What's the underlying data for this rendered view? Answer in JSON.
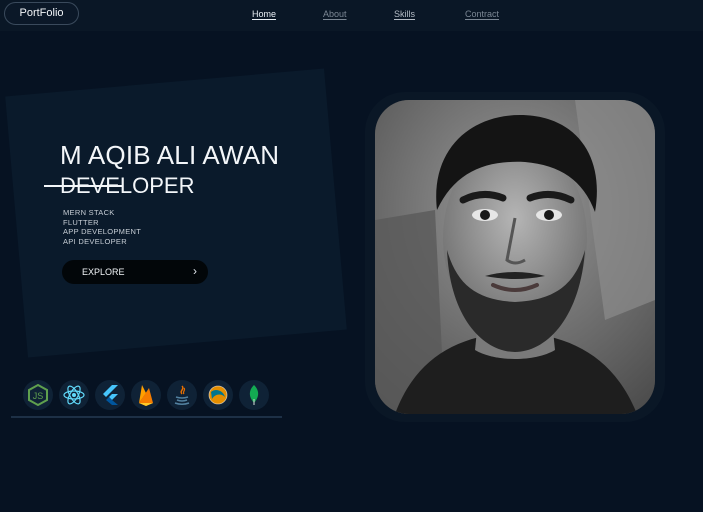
{
  "nav": {
    "logo": "PortFolio",
    "links": [
      "Home",
      "About",
      "Skills",
      "Contract"
    ]
  },
  "hero": {
    "name": "M AQIB ALI AWAN",
    "role": "DEVELOPER",
    "skills": [
      "MERN STACK",
      "FLUTTER",
      "APP DEVELOPMENT",
      "API DEVELOPER"
    ],
    "button": "EXPLORE"
  },
  "tech_icons": [
    "nodejs-icon",
    "react-icon",
    "flutter-icon",
    "firebase-icon",
    "java-icon",
    "mysql-icon",
    "mongodb-icon"
  ],
  "colors": {
    "background": "#061222",
    "card": "#0a1a2b",
    "button": "#020609"
  }
}
